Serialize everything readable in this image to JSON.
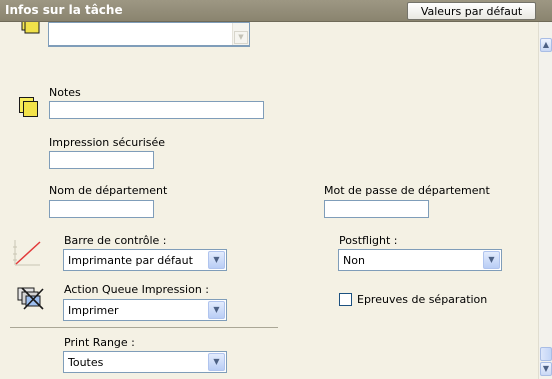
{
  "header": {
    "title": "Infos sur la tâche",
    "defaults_button": "Valeurs par défaut"
  },
  "notes": {
    "label": "Notes",
    "value": ""
  },
  "secure_print": {
    "label": "Impression sécurisée",
    "value": ""
  },
  "department_name": {
    "label": "Nom de département",
    "value": ""
  },
  "department_password": {
    "label": "Mot de passe de département",
    "value": ""
  },
  "control_bar": {
    "label": "Barre de contrôle :",
    "value": "Imprimante par défaut"
  },
  "postflight": {
    "label": "Postflight :",
    "value": "Non"
  },
  "queue_action": {
    "label": "Action Queue Impression :",
    "value": "Imprimer"
  },
  "separation_proofs": {
    "label": "Epreuves de séparation",
    "checked": false
  },
  "print_range": {
    "label": "Print Range :",
    "value": "Toutes"
  },
  "icons": [
    "notes-icon",
    "control-bar-icon",
    "queue-action-icon"
  ]
}
